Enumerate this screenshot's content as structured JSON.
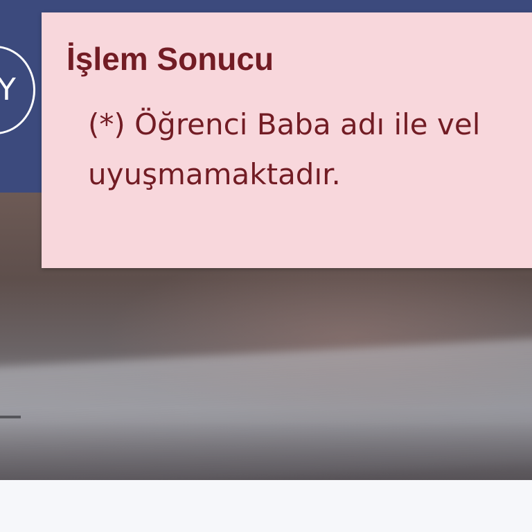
{
  "header": {
    "logo_letter": "Y",
    "band_color": "#3c4a7d"
  },
  "alert": {
    "title": "İşlem Sonucu",
    "message_line1": "(*) Öğrenci Baba adı ile vel",
    "message_line2": "uyuşmamaktadır.",
    "background_color": "#f8d7dc",
    "text_color": "#721c24"
  }
}
